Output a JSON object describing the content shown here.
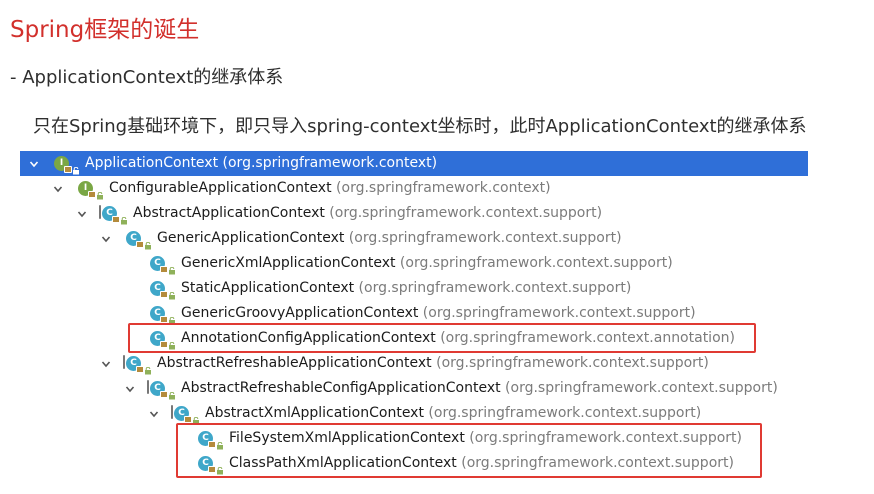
{
  "page": {
    "title": "Spring框架的诞生",
    "subtitle": "- ApplicationContext的继承体系",
    "description": "只在Spring基础环境下，即只导入spring-context坐标时，此时ApplicationContext的继承体系"
  },
  "tree": {
    "nodes": [
      {
        "name": "ApplicationContext",
        "pkg": "(org.springframework.context)",
        "kind": "interface",
        "depth": 0,
        "expanded": true,
        "selected": true
      },
      {
        "name": "ConfigurableApplicationContext",
        "pkg": "(org.springframework.context)",
        "kind": "interface",
        "depth": 1,
        "expanded": true
      },
      {
        "name": "AbstractApplicationContext",
        "pkg": "(org.springframework.context.support)",
        "kind": "abstract-class",
        "depth": 2,
        "expanded": true
      },
      {
        "name": "GenericApplicationContext",
        "pkg": "(org.springframework.context.support)",
        "kind": "class",
        "depth": 3,
        "expanded": true
      },
      {
        "name": "GenericXmlApplicationContext",
        "pkg": "(org.springframework.context.support)",
        "kind": "class",
        "depth": 4
      },
      {
        "name": "StaticApplicationContext",
        "pkg": "(org.springframework.context.support)",
        "kind": "class",
        "depth": 4
      },
      {
        "name": "GenericGroovyApplicationContext",
        "pkg": "(org.springframework.context.support)",
        "kind": "class",
        "depth": 4
      },
      {
        "name": "AnnotationConfigApplicationContext",
        "pkg": "(org.springframework.context.annotation)",
        "kind": "class",
        "depth": 4
      },
      {
        "name": "AbstractRefreshableApplicationContext",
        "pkg": "(org.springframework.context.support)",
        "kind": "abstract-class",
        "depth": 3,
        "expanded": true
      },
      {
        "name": "AbstractRefreshableConfigApplicationContext",
        "pkg": "(org.springframework.context.support)",
        "kind": "abstract-class",
        "depth": 4,
        "expanded": true
      },
      {
        "name": "AbstractXmlApplicationContext",
        "pkg": "(org.springframework.context.support)",
        "kind": "abstract-class",
        "depth": 5,
        "expanded": true
      },
      {
        "name": "FileSystemXmlApplicationContext",
        "pkg": "(org.springframework.context.support)",
        "kind": "class",
        "depth": 6
      },
      {
        "name": "ClassPathXmlApplicationContext",
        "pkg": "(org.springframework.context.support)",
        "kind": "class",
        "depth": 6
      }
    ]
  },
  "icons": {
    "class": "class-c-icon",
    "interface": "interface-i-icon",
    "lock": "lock-icon",
    "public": "public-access-icon",
    "expand": "chevron-down-icon"
  },
  "colors": {
    "title": "#d2302c",
    "selection": "#2f6fd8",
    "class_icon": "#3fa7c9",
    "interface_icon": "#7aa745",
    "highlight_box": "#e03a33",
    "package_text": "#7b7b7b"
  }
}
